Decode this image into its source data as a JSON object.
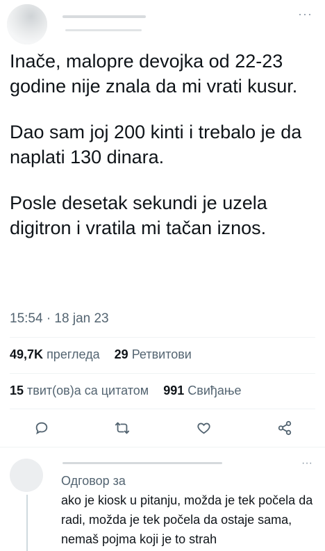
{
  "tweet": {
    "paragraphs": [
      "Inače, malopre devojka od 22-23 godine nije znala da mi vrati kusur.",
      "Dao sam joj 200 kinti i trebalo je da naplati 130 dinara.",
      "Posle desetak sekundi je uzela digitron i vratila mi tačan iznos."
    ],
    "time": "15:54 · 18 jan 23"
  },
  "stats": {
    "views_count": "49,7K",
    "views_label": "прегледа",
    "retweets_count": "29",
    "retweets_label": "Ретвитови",
    "quotes_count": "15",
    "quotes_label": "твит(ов)а са цитатом",
    "likes_count": "991",
    "likes_label": "Свиђање"
  },
  "actions": {
    "reply_icon": "reply-icon",
    "retweet_icon": "retweet-icon",
    "like_icon": "heart-icon",
    "share_icon": "share-icon"
  },
  "reply": {
    "reply_to_label": "Одговор за",
    "text": "ako je kiosk u pitanju, možda je tek počela da radi, možda je tek počela da ostaje sama, nemaš pojma koji je to strah"
  },
  "colors": {
    "text": "#0f1419",
    "secondary": "#536471",
    "divider": "#eff3f4"
  }
}
